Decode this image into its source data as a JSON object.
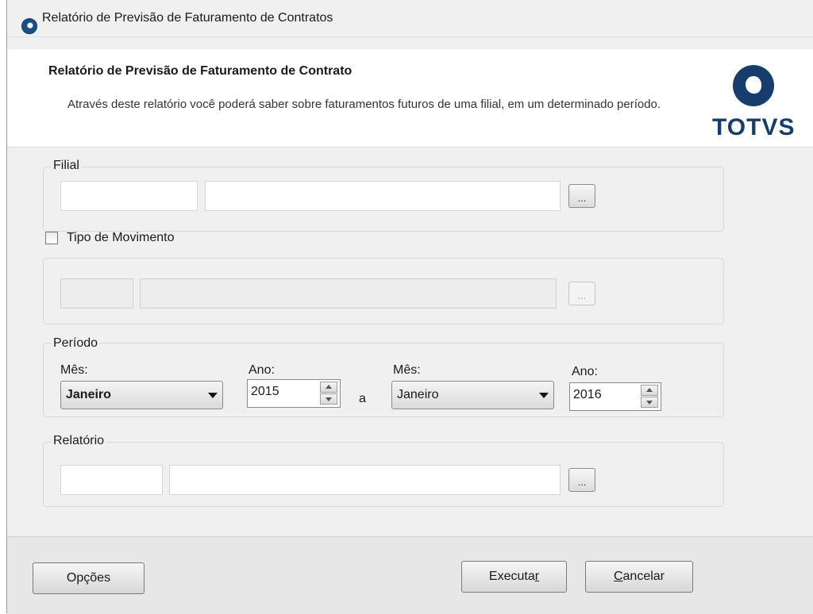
{
  "window": {
    "title": "Relatório de Previsão de Faturamento de Contratos"
  },
  "header": {
    "title": "Relatório de Previsão de Faturamento de Contrato",
    "description": "Através deste relatório você poderá saber sobre faturamentos futuros de uma filial, em um determinado período.",
    "logo_text": "TOTVS"
  },
  "filial": {
    "label": "Filial",
    "code_value": "",
    "name_value": "",
    "lookup_label": "..."
  },
  "tipo_movimento": {
    "label": "Tipo de Movimento",
    "checked": false,
    "code_value": "",
    "name_value": "",
    "lookup_label": "..."
  },
  "periodo": {
    "label": "Período",
    "month_label": "Mês:",
    "year_label": "Ano:",
    "start_month": "Janeiro",
    "start_year": "2015",
    "separator": "a",
    "end_month": "Janeiro",
    "end_year": "2016"
  },
  "relatorio": {
    "label": "Relatório",
    "code_value": "",
    "name_value": "",
    "lookup_label": "..."
  },
  "footer": {
    "options_label": "Opções",
    "execute_label": "Executa",
    "execute_mnemonic": "r",
    "cancel_mnemonic": "C",
    "cancel_label": "ancelar"
  }
}
